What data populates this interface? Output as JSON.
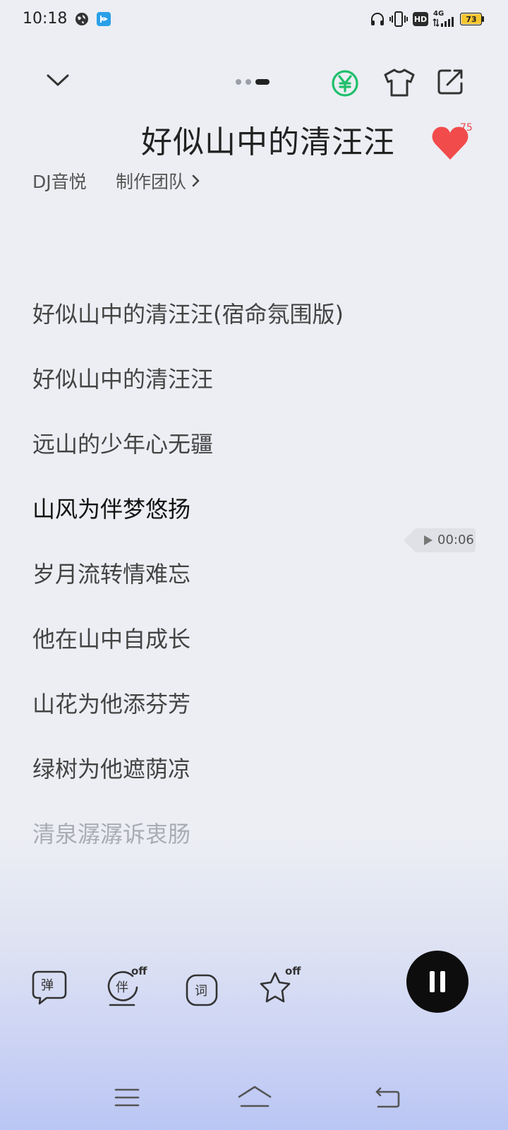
{
  "status_bar": {
    "time": "10:18",
    "network": "4G",
    "hd": "HD",
    "battery": "73"
  },
  "header": {
    "page_count": 3,
    "active_page": 3
  },
  "song": {
    "title": "好似山中的清汪汪",
    "artist": "DJ音悦",
    "team_label": "制作团队",
    "like_count": "75"
  },
  "lyrics": [
    "好似山中的清汪汪(宿命氛围版)",
    "好似山中的清汪汪",
    "远山的少年心无疆",
    "山风为伴梦悠扬",
    "岁月流转情难忘",
    "他在山中自成长",
    "山花为他添芬芳",
    "绿树为他遮荫凉",
    "清泉潺潺诉衷肠"
  ],
  "current_lyric_index": 3,
  "seek_badge": {
    "time": "00:06"
  },
  "controls": {
    "danmaku_label": "弹",
    "accompany_label": "伴",
    "accompany_state": "off",
    "lyrics_label": "词",
    "favorite_state": "off"
  },
  "colors": {
    "like": "#f24b4b",
    "vip": "#1fbf6b",
    "pause_bg": "#0d0d0d"
  },
  "icons": [
    "globe-icon",
    "app-notification-icon",
    "headset-icon",
    "vibrate-icon",
    "signal-icon",
    "battery-icon",
    "chevron-down-icon",
    "vip-yen-icon",
    "tshirt-icon",
    "share-icon",
    "heart-icon",
    "chevron-right-icon",
    "play-icon",
    "danmaku-icon",
    "accompany-icon",
    "lyrics-icon",
    "star-icon",
    "pause-icon",
    "menu-icon",
    "home-icon",
    "back-icon"
  ]
}
